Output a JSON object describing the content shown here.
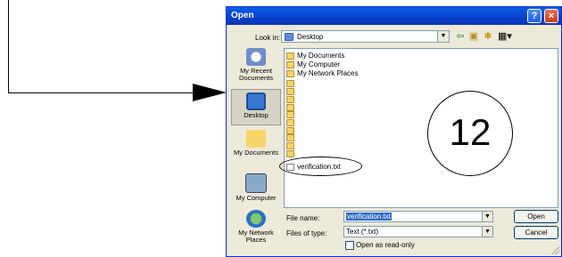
{
  "annotation": {
    "step_number": "12"
  },
  "dialog": {
    "title": "Open",
    "help_glyph": "?",
    "close_glyph": "×",
    "look_in_label": "Look in:",
    "look_in_value": "Desktop",
    "places": [
      {
        "label": "My Recent Documents"
      },
      {
        "label": "Desktop"
      },
      {
        "label": "My Documents"
      },
      {
        "label": "My Computer"
      },
      {
        "label": "My Network Places"
      }
    ],
    "files": [
      {
        "name": "My Documents",
        "type": "system"
      },
      {
        "name": "My Computer",
        "type": "system"
      },
      {
        "name": "My Network Places",
        "type": "system"
      },
      {
        "name": "",
        "type": "folder"
      },
      {
        "name": "",
        "type": "folder"
      },
      {
        "name": "",
        "type": "folder"
      },
      {
        "name": "",
        "type": "folder"
      },
      {
        "name": "",
        "type": "folder"
      },
      {
        "name": "",
        "type": "folder"
      },
      {
        "name": "",
        "type": "folder"
      },
      {
        "name": "",
        "type": "folder"
      },
      {
        "name": "",
        "type": "folder"
      },
      {
        "name": "",
        "type": "folder"
      },
      {
        "name": "verification.txt",
        "type": "txt"
      }
    ],
    "file_name_label": "File name:",
    "file_name_value": "verification.txt",
    "files_of_type_label": "Files of type:",
    "files_of_type_value": "Text (*.txt)",
    "read_only_label": "Open as read-only",
    "open_button": "Open",
    "cancel_button": "Cancel"
  }
}
